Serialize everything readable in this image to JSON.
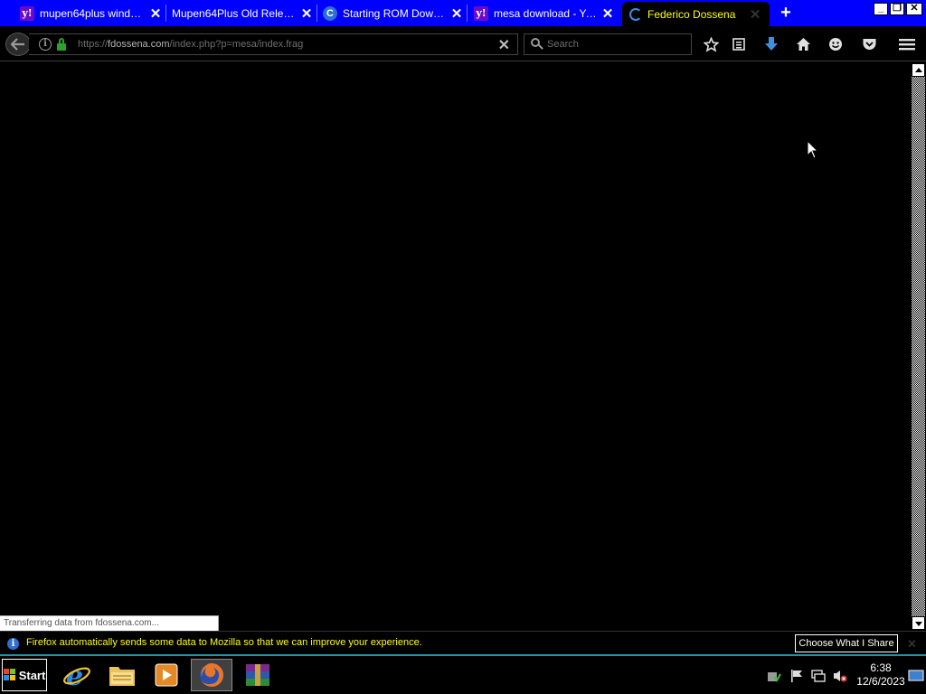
{
  "tabs": [
    {
      "title": "mupen64plus window...",
      "favicon": "yahoo-y-icon",
      "active": false
    },
    {
      "title": "Mupen64Plus Old Releases",
      "favicon": "none",
      "active": false
    },
    {
      "title": "Starting ROM Downlo...",
      "favicon": "c-circle-icon",
      "active": false
    },
    {
      "title": "mesa download - Yah...",
      "favicon": "yahoo-y-icon",
      "active": false
    },
    {
      "title": "Federico Dossena",
      "favicon": "loading-spinner-icon",
      "active": true
    }
  ],
  "tab_favicon_glyphs": {
    "yahoo": "y!",
    "c": "C"
  },
  "tab_close_glyph": "✕",
  "new_tab_glyph": "+",
  "window_controls": {
    "minimize": "_",
    "restore": "❐",
    "close": "✕"
  },
  "url": {
    "prefix": "https://",
    "host": "fdossena.com",
    "path": "/index.php?p=mesa/index.frag"
  },
  "url_clear_glyph": "✕",
  "search": {
    "placeholder": "Search"
  },
  "nav_icons": {
    "back": "back-arrow-icon",
    "bookmark": "star-icon",
    "reading": "clipboard-icon",
    "download": "download-arrow-icon",
    "home": "home-icon",
    "feedback": "smiley-icon",
    "pocket": "pocket-icon",
    "menu": "hamburger-menu-icon"
  },
  "status": {
    "text": "Transferring data from fdossena.com..."
  },
  "notification": {
    "icon": "i",
    "message": "Firefox automatically sends some data to Mozilla so that we can improve your experience.",
    "button": "Choose What I Share",
    "close": "✕"
  },
  "taskbar": {
    "start_label": "Start",
    "pinned": [
      "internet-explorer-icon",
      "file-explorer-icon",
      "media-player-icon",
      "firefox-icon",
      "winrar-icon"
    ],
    "active_pinned": "firefox-icon"
  },
  "tray": {
    "icons": [
      "security-shield-icon",
      "action-center-flag-icon",
      "network-icon",
      "volume-muted-icon"
    ],
    "time": "6:38",
    "date": "12/6/2023"
  },
  "colors": {
    "tab_strip": "#0000ff",
    "active_tab_text": "#ffff00",
    "notification_text": "#ffff00",
    "lock_green": "#29a329",
    "download_blue": "#3d8fe0",
    "taskbar_accent": "#2a8fa0"
  }
}
